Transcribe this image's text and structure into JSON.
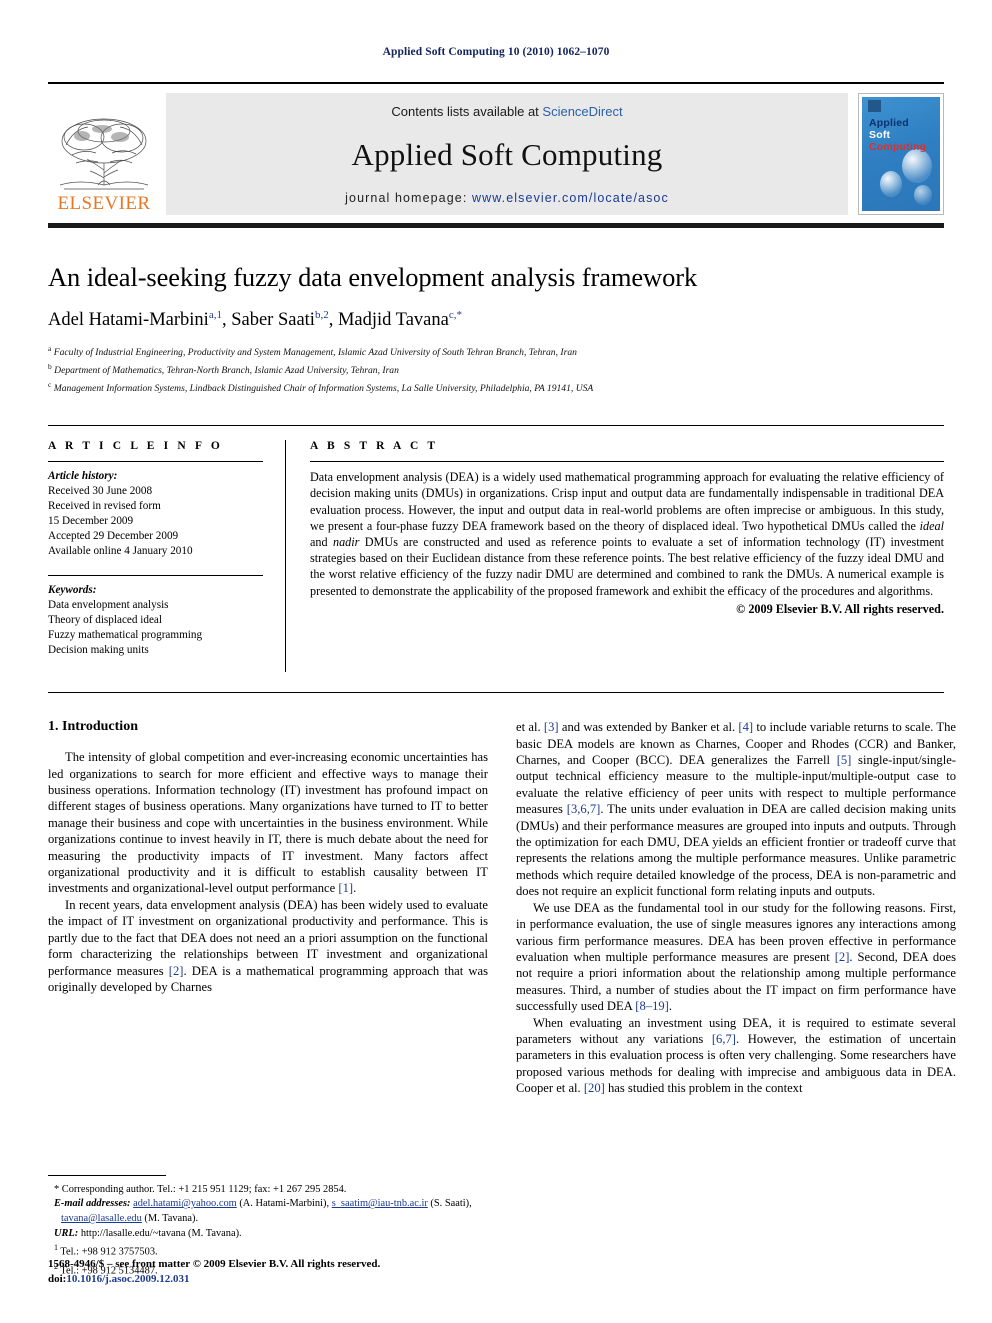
{
  "running_head": "Applied Soft Computing 10 (2010) 1062–1070",
  "masthead": {
    "publisher_name": "ELSEVIER",
    "contents_prefix": "Contents lists available at ",
    "contents_link": "ScienceDirect",
    "journal_title": "Applied Soft Computing",
    "homepage_prefix": "journal homepage: ",
    "homepage_url": "www.elsevier.com/locate/asoc",
    "cover": {
      "line1": "Applied",
      "line2": "Soft",
      "line3": "Computing"
    },
    "colors": {
      "elsevier_orange": "#E87722",
      "link_blue": "#2b5faa",
      "cover_blue": "#2f7fc2",
      "cover_red": "#d9322c"
    }
  },
  "title": "An ideal-seeking fuzzy data envelopment analysis framework",
  "authors": [
    {
      "name": "Adel Hatami-Marbini",
      "marks": "a,1",
      "sep": ", "
    },
    {
      "name": "Saber Saati",
      "marks": "b,2",
      "sep": ", "
    },
    {
      "name": "Madjid Tavana",
      "marks": "c,*",
      "sep": ""
    }
  ],
  "affiliations": [
    {
      "mark": "a",
      "text": "Faculty of Industrial Engineering, Productivity and System Management, Islamic Azad University of South Tehran Branch, Tehran, Iran"
    },
    {
      "mark": "b",
      "text": "Department of Mathematics, Tehran-North Branch, Islamic Azad University, Tehran, Iran"
    },
    {
      "mark": "c",
      "text": "Management Information Systems, Lindback Distinguished Chair of Information Systems, La Salle University, Philadelphia, PA 19141, USA"
    }
  ],
  "article_info": {
    "heading": "A R T I C L E   I N F O",
    "history_label": "Article history:",
    "history": [
      "Received 30 June 2008",
      "Received in revised form",
      "15 December 2009",
      "Accepted 29 December 2009",
      "Available online 4 January 2010"
    ],
    "keywords_label": "Keywords:",
    "keywords": [
      "Data envelopment analysis",
      "Theory of displaced ideal",
      "Fuzzy mathematical programming",
      "Decision making units"
    ]
  },
  "abstract": {
    "heading": "A B S T R A C T",
    "body_1": "Data envelopment analysis (DEA) is a widely used mathematical programming approach for evaluating the relative efficiency of decision making units (DMUs) in organizations. Crisp input and output data are fundamentally indispensable in traditional DEA evaluation process. However, the input and output data in real-world problems are often imprecise or ambiguous. In this study, we present a four-phase fuzzy DEA framework based on the theory of displaced ideal. Two hypothetical DMUs called the ",
    "italic_1": "ideal",
    "body_2": " and ",
    "italic_2": "nadir",
    "body_3": " DMUs are constructed and used as reference points to evaluate a set of information technology (IT) investment strategies based on their Euclidean distance from these reference points. The best relative efficiency of the fuzzy ideal DMU and the worst relative efficiency of the fuzzy nadir DMU are determined and combined to rank the DMUs. A numerical example is presented to demonstrate the applicability of the proposed framework and exhibit the efficacy of the procedures and algorithms.",
    "copyright": "© 2009 Elsevier B.V. All rights reserved."
  },
  "section": {
    "number_title": "1.  Introduction"
  },
  "left_column": {
    "p1_a": "The intensity of global competition and ever-increasing economic uncertainties has led organizations to search for more efficient and effective ways to manage their business operations. Information technology (IT) investment has profound impact on different stages of business operations. Many organizations have turned to IT to better manage their business and cope with uncertainties in the business environment. While organizations continue to invest heavily in IT, there is much debate about the need for measuring the productivity impacts of IT investment. Many factors affect organizational productivity and it is difficult to establish causality between IT investments and organizational-level output performance ",
    "p1_ref": "[1]",
    "p1_b": ".",
    "p2_a": "In recent years, data envelopment analysis (DEA) has been widely used to evaluate the impact of IT investment on organizational productivity and performance. This is partly due to the fact that DEA does not need an a priori assumption on the functional form characterizing the relationships between IT investment and organizational performance measures ",
    "p2_ref": "[2]",
    "p2_b": ". DEA is a mathematical programming approach that was originally developed by Charnes"
  },
  "right_column": {
    "p1_a": "et al. ",
    "p1_ref1": "[3]",
    "p1_b": " and was extended by Banker et al. ",
    "p1_ref2": "[4]",
    "p1_c": " to include variable returns to scale. The basic DEA models are known as Charnes, Cooper and Rhodes (CCR) and Banker, Charnes, and Cooper (BCC). DEA generalizes the Farrell ",
    "p1_ref3": "[5]",
    "p1_d": " single-input/single-output technical efficiency measure to the multiple-input/multiple-output case to evaluate the relative efficiency of peer units with respect to multiple performance measures ",
    "p1_ref4": "[3,6,7]",
    "p1_e": ". The units under evaluation in DEA are called decision making units (DMUs) and their performance measures are grouped into inputs and outputs. Through the optimization for each DMU, DEA yields an efficient frontier or tradeoff curve that represents the relations among the multiple performance measures. Unlike parametric methods which require detailed knowledge of the process, DEA is non-parametric and does not require an explicit functional form relating inputs and outputs.",
    "p2_a": "We use DEA as the fundamental tool in our study for the following reasons. First, in performance evaluation, the use of single measures ignores any interactions among various firm performance measures. DEA has been proven effective in performance evaluation when multiple performance measures are present ",
    "p2_ref1": "[2]",
    "p2_b": ". Second, DEA does not require a priori information about the relationship among multiple performance measures. Third, a number of studies about the IT impact on firm performance have successfully used DEA ",
    "p2_ref2": "[8–19]",
    "p2_c": ".",
    "p3_a": "When evaluating an investment using DEA, it is required to estimate several parameters without any variations ",
    "p3_ref1": "[6,7]",
    "p3_b": ". However, the estimation of uncertain parameters in this evaluation process is often very challenging. Some researchers have proposed various methods for dealing with imprecise and ambiguous data in DEA. Cooper et al. ",
    "p3_ref2": "[20]",
    "p3_c": " has studied this problem in the context"
  },
  "footnotes": {
    "corresponding": "* Corresponding author. Tel.: +1 215 951 1129; fax: +1 267 295 2854.",
    "email_label": "E-mail addresses:",
    "email_1": "adel.hatami@yahoo.com",
    "email_1_suffix": " (A. Hatami-Marbini),",
    "email_2": "s_saatim@iau-tnb.ac.ir",
    "email_2_suffix": " (S. Saati), ",
    "email_3": "tavana@lasalle.edu",
    "email_3_suffix": " (M. Tavana).",
    "url_label": "URL:",
    "url_value": " http://lasalle.edu/~tavana (M. Tavana).",
    "tel_1_mark": "1",
    "tel_1": " Tel.: +98 912 3757503.",
    "tel_2_mark": "2",
    "tel_2": " Tel.: +98 912 5134487."
  },
  "page_footer": {
    "issn_line": "1568-4946/$ – see front matter © 2009 Elsevier B.V. All rights reserved.",
    "doi_label": "doi:",
    "doi_value": "10.1016/j.asoc.2009.12.031"
  }
}
